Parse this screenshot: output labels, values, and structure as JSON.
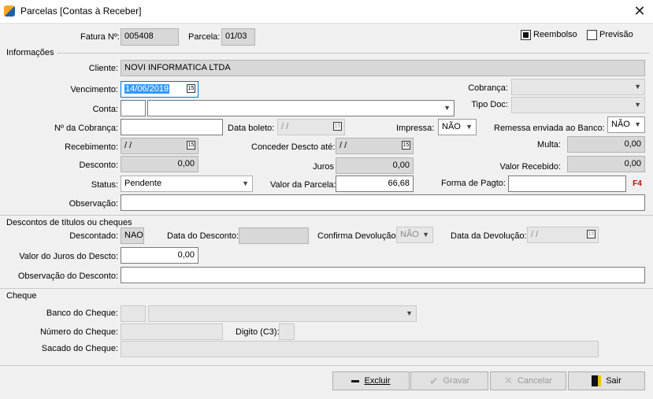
{
  "window": {
    "title": "Parcelas  [Contas à Receber]"
  },
  "header": {
    "fatura_label": "Fatura Nº:",
    "fatura_value": "005408",
    "parcela_label": "Parcela:",
    "parcela_value": "01/03",
    "reembolso_label": "Reembolso",
    "reembolso_checked": true,
    "previsao_label": "Previsão",
    "previsao_checked": false
  },
  "informacoes": {
    "title": "Informações",
    "cliente_label": "Cliente:",
    "cliente_value": "NOVI INFORMATICA LTDA",
    "vencimento_label": "Vencimento:",
    "vencimento_value": "14/06/2019",
    "cobranca_label": "Cobrança:",
    "cobranca_value": "",
    "conta_label": "Conta:",
    "conta_code": "",
    "conta_value": "",
    "tipo_doc_label": "Tipo Doc:",
    "tipo_doc_value": "",
    "n_cobranca_label": "Nº da Cobrança:",
    "n_cobranca_value": "",
    "data_boleto_label": "Data boleto:",
    "data_boleto_value": " /  /",
    "impressa_label": "Impressa:",
    "impressa_value": "NÃO",
    "remessa_label": "Remessa enviada ao Banco:",
    "remessa_value": "NÃO",
    "recebimento_label": "Recebimento:",
    "recebimento_value": " /  /",
    "conceder_label": "Conceder Descto até:",
    "conceder_value": " /  /",
    "multa_label": "Multa:",
    "multa_value": "0,00",
    "desconto_label": "Desconto:",
    "desconto_value": "0,00",
    "juros_label": "Juros",
    "juros_value": "0,00",
    "valor_recebido_label": "Valor Recebido:",
    "valor_recebido_value": "0,00",
    "status_label": "Status:",
    "status_value": "Pendente",
    "valor_parcela_label": "Valor da Parcela:",
    "valor_parcela_value": "66,68",
    "forma_pagto_label": "Forma de Pagto:",
    "forma_pagto_value": "",
    "f4_label": "F4",
    "observacao_label": "Observação:",
    "observacao_value": ""
  },
  "descontos": {
    "title": "Descontos de títulos ou cheques",
    "descontado_label": "Descontado:",
    "descontado_value": "NAO",
    "data_desconto_label": "Data do Desconto:",
    "data_desconto_value": "",
    "confirma_label": "Confirma Devolução:",
    "confirma_value": "NÃO",
    "data_devolucao_label": "Data da Devolução:",
    "data_devolucao_value": " /  /",
    "valor_juros_label": "Valor do Juros  do Descto:",
    "valor_juros_value": "0,00",
    "obs_desconto_label": "Observação do Desconto:",
    "obs_desconto_value": ""
  },
  "cheque": {
    "title": "Cheque",
    "banco_label": "Banco do Cheque:",
    "banco_code": "",
    "banco_value": "",
    "numero_label": "Número do Cheque:",
    "numero_value": "",
    "digito_label": "Digito (C3):",
    "digito_value": "",
    "sacado_label": "Sacado do Cheque:",
    "sacado_value": ""
  },
  "footer": {
    "excluir": "Excluir",
    "gravar": "Gravar",
    "cancelar": "Cancelar",
    "sair": "Sair"
  }
}
